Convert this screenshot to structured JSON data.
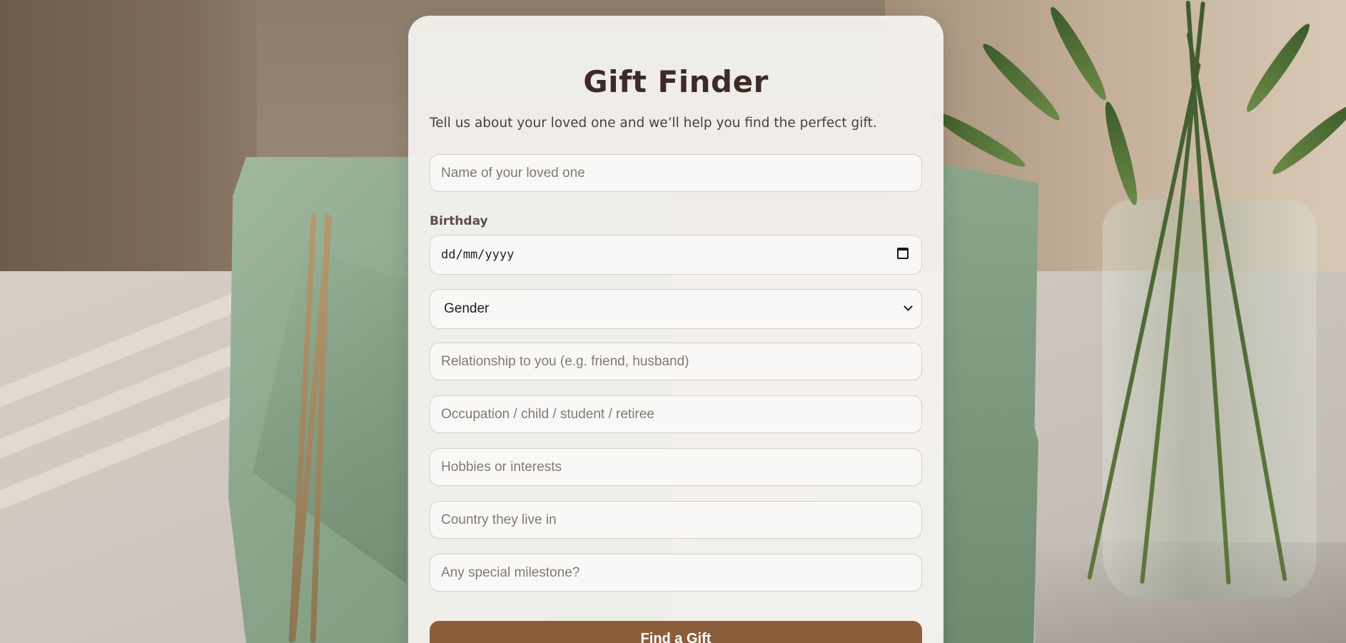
{
  "form": {
    "title": "Gift Finder",
    "subtitle": "Tell us about your loved one and we’ll help you find the perfect gift.",
    "name_placeholder": "Name of your loved one",
    "birthday_label": "Birthday",
    "birthday_placeholder": "dd/mm/yyyy",
    "gender_selected": "Gender",
    "relationship_placeholder": "Relationship to you (e.g. friend, husband)",
    "occupation_placeholder": "Occupation / child / student / retiree",
    "hobbies_placeholder": "Hobbies or interests",
    "country_placeholder": "Country they live in",
    "milestone_placeholder": "Any special milestone?",
    "submit_label": "Find a Gift"
  },
  "icons": {
    "date_picker": "calendar-icon",
    "select_arrow": "chevron-down-icon"
  },
  "colors": {
    "title": "#3e2b28",
    "submit_background": "#8b5e3c",
    "card_background": "#f4f2ef"
  }
}
